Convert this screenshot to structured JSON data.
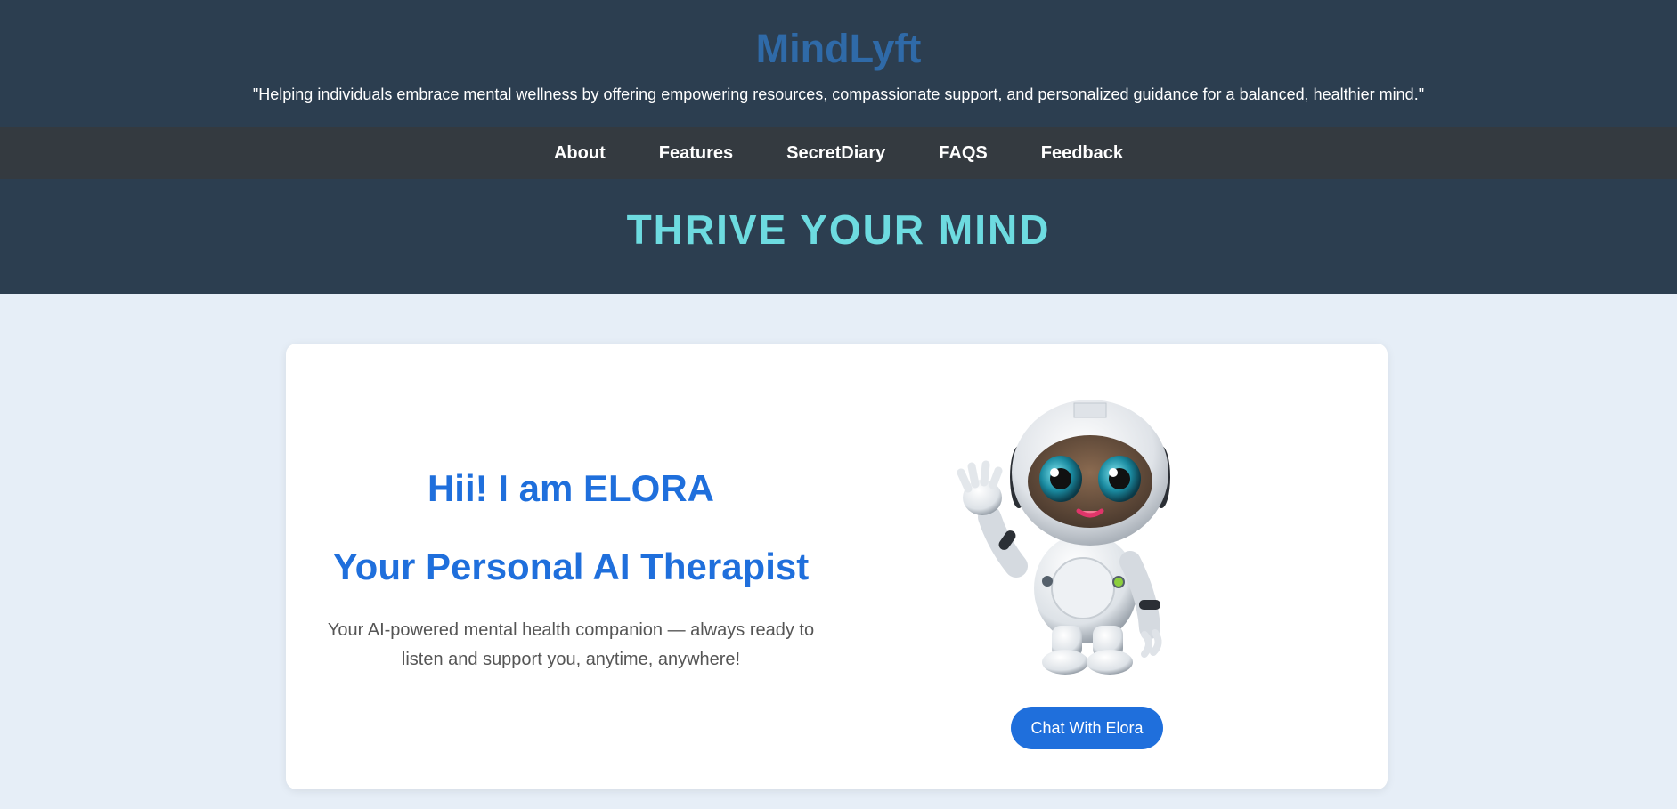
{
  "header": {
    "brand": "MindLyft",
    "tagline": "\"Helping individuals embrace mental wellness by offering empowering resources, compassionate support, and personalized guidance for a balanced, healthier mind.\""
  },
  "nav": {
    "items": [
      {
        "label": "About"
      },
      {
        "label": "Features"
      },
      {
        "label": "SecretDiary"
      },
      {
        "label": "FAQS"
      },
      {
        "label": "Feedback"
      }
    ]
  },
  "hero": {
    "title": "THRIVE YOUR MIND"
  },
  "intro": {
    "greeting": "Hii! I am ELORA",
    "role": "Your Personal AI Therapist",
    "description": "Your AI-powered mental health companion — always ready to listen and support you, anytime, anywhere!",
    "image": "robot-mascot-waving",
    "button_label": "Chat With Elora"
  },
  "colors": {
    "header_bg": "#2c3e50",
    "nav_bg": "#343a40",
    "brand": "#2f6aa8",
    "hero_title": "#6ddbe0",
    "accent": "#1f6fdc",
    "page_bg": "#e6eef7"
  }
}
